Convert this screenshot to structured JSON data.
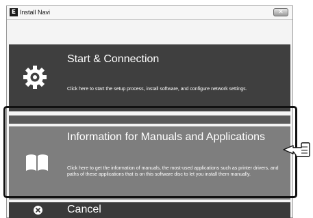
{
  "window": {
    "title": "Install Navi",
    "app_icon_letter": "E",
    "close_glyph": "✕"
  },
  "menu": {
    "start": {
      "title": "Start & Connection",
      "description": "Click here to start the setup process, install software, and configure network settings.",
      "icon": "gear-icon"
    },
    "info": {
      "title": "Information for Manuals and Applications",
      "description": "Click here to get the information of manuals, the most-used applications such as printer drivers, and paths of these applications that is on this software disc to let you install them manually.",
      "icon": "book-icon"
    },
    "cancel": {
      "title": "Cancel",
      "icon": "cancel-icon"
    }
  },
  "annotation": {
    "pointer_icon": "pointing-hand-icon"
  },
  "colors": {
    "start_bg": "#3f3f3f",
    "info_bg": "#7e7e7e",
    "cancel_bg": "#3a3a3a",
    "highlight_frame": "#111111"
  }
}
